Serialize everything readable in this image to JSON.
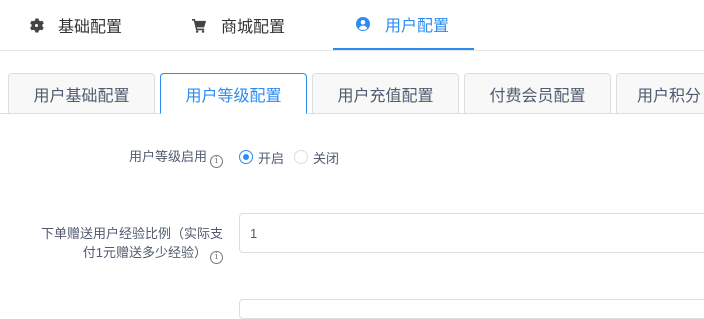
{
  "top_tabs": [
    {
      "label": "基础配置",
      "icon": "gear-icon"
    },
    {
      "label": "商城配置",
      "icon": "cart-icon"
    },
    {
      "label": "用户配置",
      "icon": "user-circle-icon",
      "active": true
    }
  ],
  "sub_tabs": [
    {
      "label": "用户基础配置"
    },
    {
      "label": "用户等级配置",
      "active": true
    },
    {
      "label": "用户充值配置"
    },
    {
      "label": "付费会员配置"
    },
    {
      "label": "用户积分"
    }
  ],
  "form": {
    "level_enable": {
      "label": "用户等级启用",
      "options": [
        "开启",
        "关闭"
      ],
      "selected": "开启"
    },
    "exp_ratio": {
      "label_line1": "下单赠送用户经验比例（实际支",
      "label_line2": "付1元赠送多少经验）",
      "value": "1"
    }
  },
  "colors": {
    "accent": "#2d8cf0",
    "border": "#dcdee2",
    "text": "#515a6e"
  }
}
